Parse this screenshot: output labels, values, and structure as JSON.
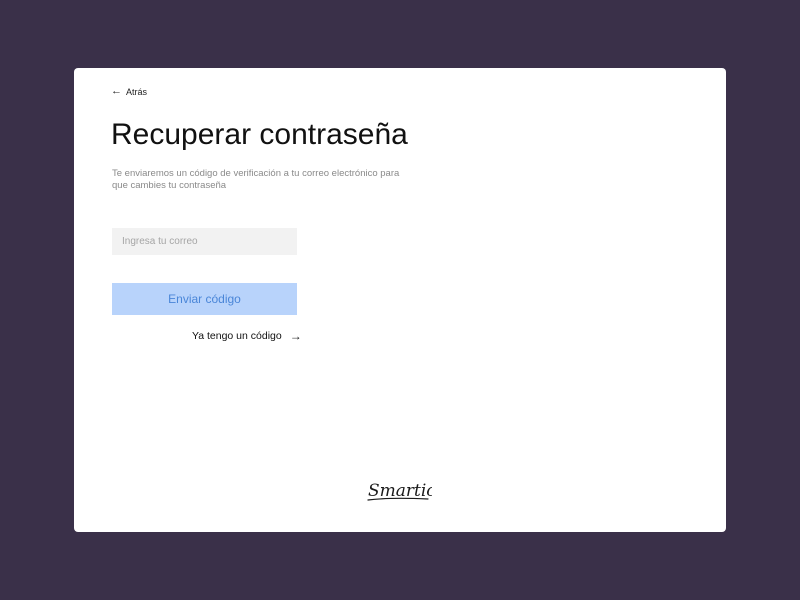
{
  "nav": {
    "back_label": "Atrás"
  },
  "page": {
    "title": "Recuperar contraseña",
    "subtitle": "Te enviaremos un código de verificación a tu correo electrónico para que cambies tu contraseña"
  },
  "form": {
    "email_placeholder": "Ingresa tu correo",
    "email_value": "",
    "submit_label": "Enviar código",
    "have_code_label": "Ya tengo un código"
  },
  "brand": {
    "logo_text": "Smartic"
  },
  "colors": {
    "background": "#3a3049",
    "card": "#ffffff",
    "button_bg": "#b8d3fb",
    "button_text": "#4a86d8",
    "input_bg": "#f2f2f2"
  },
  "icons": {
    "back": "arrow-left-icon",
    "forward": "arrow-right-icon"
  }
}
